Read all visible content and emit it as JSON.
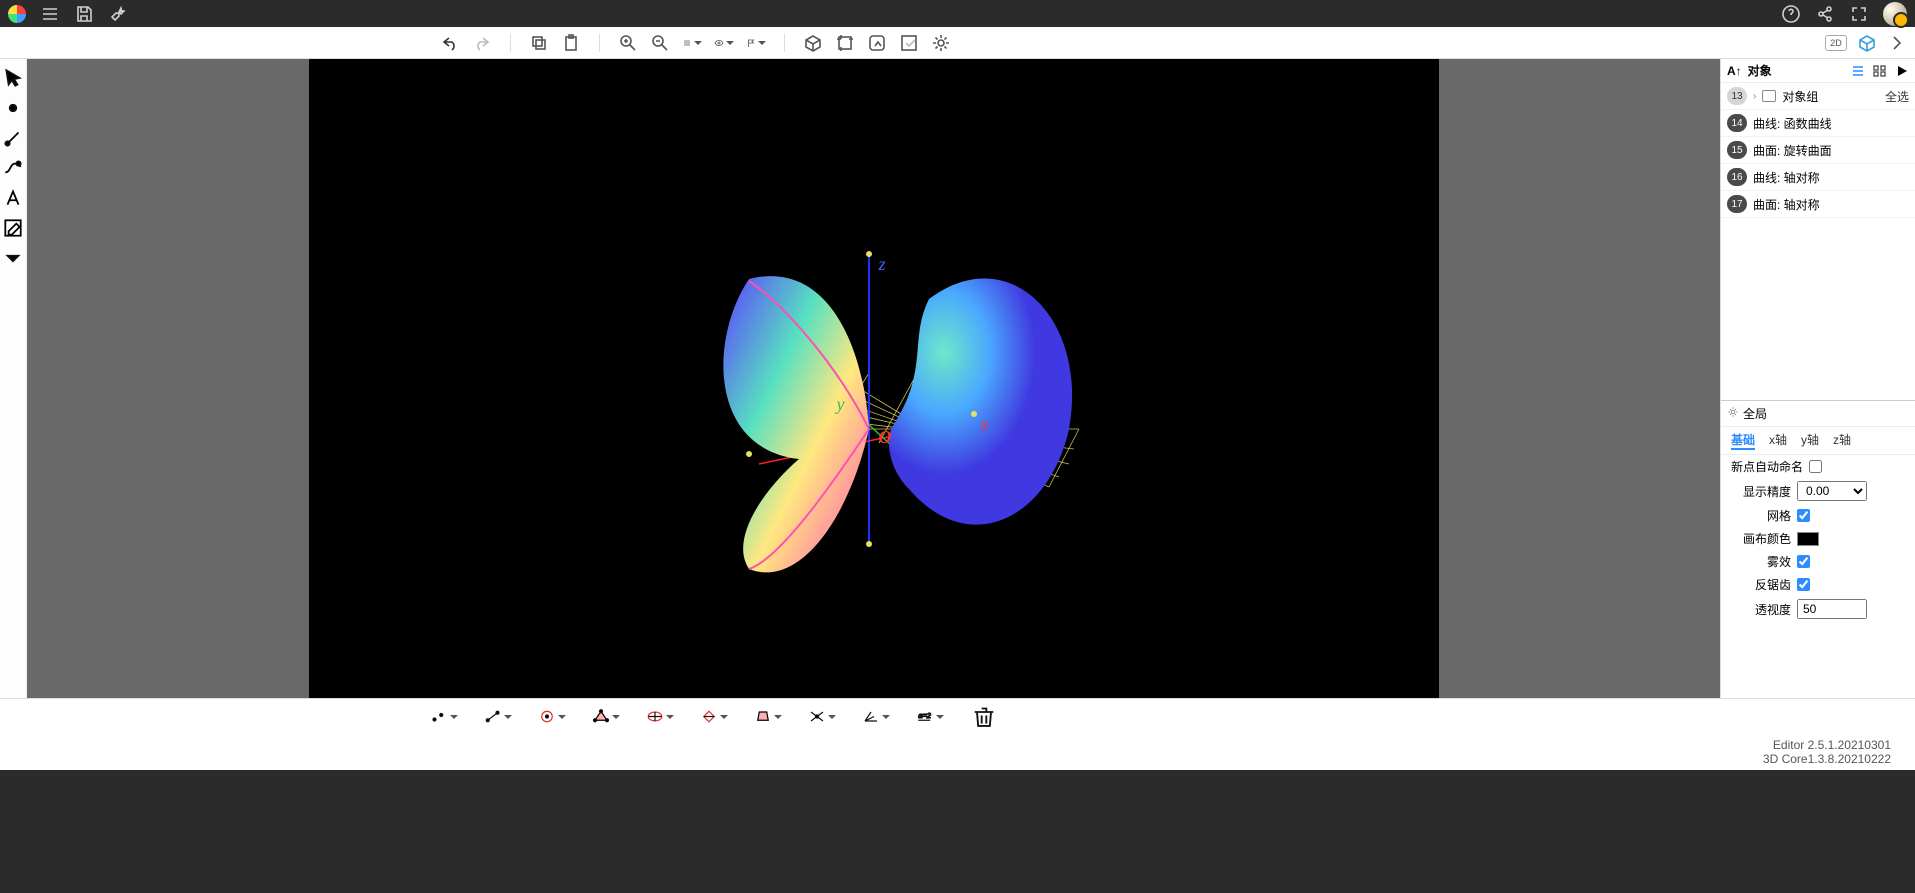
{
  "header": {
    "menu_icon": "menu",
    "save_icon": "save",
    "settings_icon": "wrench"
  },
  "objects_panel": {
    "title": "对象",
    "select_all": "全选",
    "items": [
      {
        "id": "13",
        "label": "对象组",
        "folder": true
      },
      {
        "id": "14",
        "label": "曲线: 函数曲线"
      },
      {
        "id": "15",
        "label": "曲面: 旋转曲面"
      },
      {
        "id": "16",
        "label": "曲线: 轴对称"
      },
      {
        "id": "17",
        "label": "曲面: 轴对称"
      }
    ]
  },
  "global_panel": {
    "title": "全局",
    "tabs": [
      "基础",
      "x轴",
      "y轴",
      "z轴"
    ],
    "active_tab": 0,
    "props": {
      "auto_name_label": "新点自动命名",
      "auto_name": false,
      "precision_label": "显示精度",
      "precision": "0.00",
      "grid_label": "网格",
      "grid": true,
      "canvas_color_label": "画布颜色",
      "canvas_color": "#000000",
      "fog_label": "雾效",
      "fog": true,
      "antialias_label": "反锯齿",
      "antialias": true,
      "perspective_label": "透视度",
      "perspective": "50"
    }
  },
  "viewport": {
    "axes": {
      "x": "x",
      "y": "y",
      "z": "z",
      "origin": "O"
    }
  },
  "footer": {
    "line1": "Editor 2.5.1.20210301",
    "line2": "3D Core1.3.8.20210222"
  },
  "toolbar_right": {
    "mode2d": "2D"
  }
}
